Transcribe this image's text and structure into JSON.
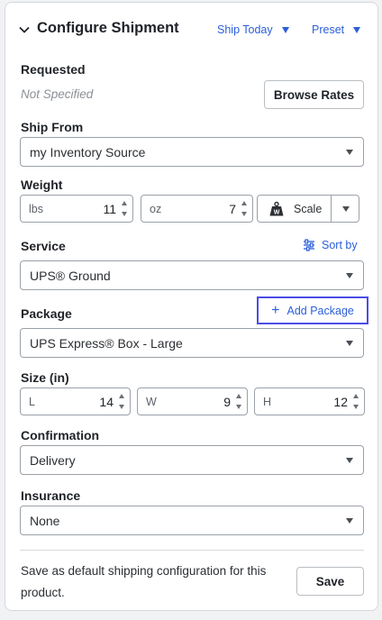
{
  "header": {
    "title": "Configure Shipment",
    "ship_today": "Ship Today",
    "preset": "Preset"
  },
  "requested": {
    "label": "Requested",
    "value": "Not Specified",
    "browse_rates": "Browse Rates"
  },
  "ship_from": {
    "label": "Ship From",
    "value": "my Inventory Source"
  },
  "weight": {
    "label": "Weight",
    "lbs_unit": "lbs",
    "lbs_value": "11",
    "oz_unit": "oz",
    "oz_value": "7",
    "scale_label": "Scale"
  },
  "service": {
    "label": "Service",
    "sort_by": "Sort by",
    "value": "UPS® Ground"
  },
  "package": {
    "label": "Package",
    "add_package": "Add Package",
    "value": "UPS Express® Box - Large"
  },
  "size": {
    "label": "Size (in)",
    "l_unit": "L",
    "l_value": "14",
    "w_unit": "W",
    "w_value": "9",
    "h_unit": "H",
    "h_value": "12"
  },
  "confirmation": {
    "label": "Confirmation",
    "value": "Delivery"
  },
  "insurance": {
    "label": "Insurance",
    "value": "None"
  },
  "footer": {
    "text": "Save as default shipping configuration for this product.",
    "save": "Save"
  },
  "colors": {
    "link": "#2b5fd9",
    "highlight_border": "#4a4de6"
  }
}
